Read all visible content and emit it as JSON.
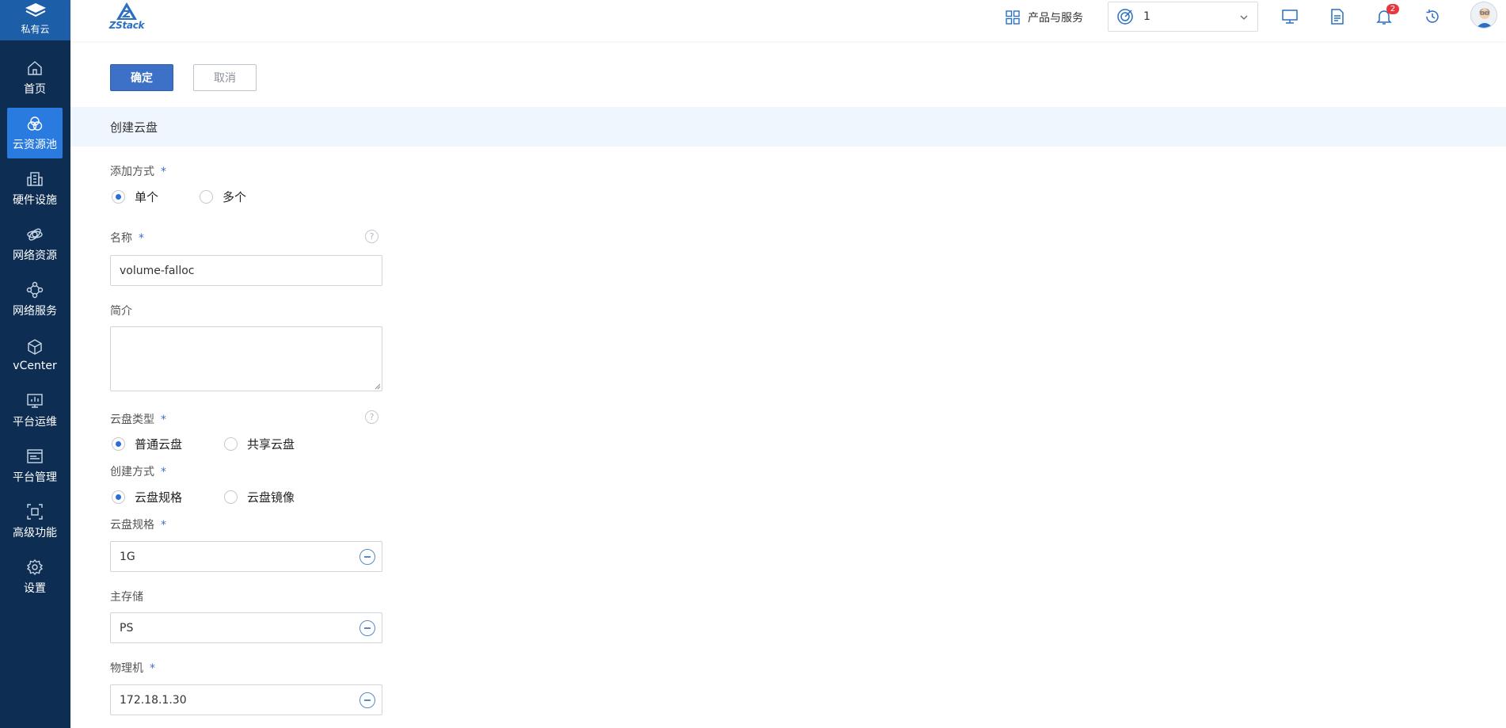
{
  "sidebar": {
    "brand_label": "私有云",
    "items": [
      {
        "label": "首页",
        "icon": "home-icon"
      },
      {
        "label": "云资源池",
        "icon": "cloud-pool-icon",
        "active": true
      },
      {
        "label": "硬件设施",
        "icon": "building-icon"
      },
      {
        "label": "网络资源",
        "icon": "network-resource-icon"
      },
      {
        "label": "网络服务",
        "icon": "network-service-icon"
      },
      {
        "label": "vCenter",
        "icon": "cube-icon"
      },
      {
        "label": "平台运维",
        "icon": "monitor-chart-icon"
      },
      {
        "label": "平台管理",
        "icon": "browser-icon"
      },
      {
        "label": "高级功能",
        "icon": "advanced-icon"
      },
      {
        "label": "设置",
        "icon": "gear-icon"
      }
    ]
  },
  "header": {
    "logo_text": "ZStack",
    "products_label": "产品与服务",
    "zone_value": "1",
    "notification_count": "2"
  },
  "actions": {
    "confirm": "确定",
    "cancel": "取消"
  },
  "form": {
    "section_title": "创建云盘",
    "add_mode": {
      "label": "添加方式",
      "required": "*",
      "options": [
        "单个",
        "多个"
      ],
      "selected": "单个"
    },
    "name": {
      "label": "名称",
      "required": "*",
      "value": "volume-falloc"
    },
    "description": {
      "label": "简介",
      "value": ""
    },
    "disk_type": {
      "label": "云盘类型",
      "required": "*",
      "options": [
        "普通云盘",
        "共享云盘"
      ],
      "selected": "普通云盘"
    },
    "create_mode": {
      "label": "创建方式",
      "required": "*",
      "options": [
        "云盘规格",
        "云盘镜像"
      ],
      "selected": "云盘规格"
    },
    "disk_offering": {
      "label": "云盘规格",
      "required": "*",
      "value": "1G"
    },
    "primary_storage": {
      "label": "主存储",
      "value": "PS"
    },
    "host": {
      "label": "物理机",
      "required": "*",
      "value": "172.18.1.30"
    }
  },
  "colors": {
    "sidebar_bg": "#0d2d52",
    "sidebar_active": "#2a7be0",
    "primary_button": "#3d70c7",
    "section_bar": "#eff6fd",
    "badge": "#e8383d"
  }
}
